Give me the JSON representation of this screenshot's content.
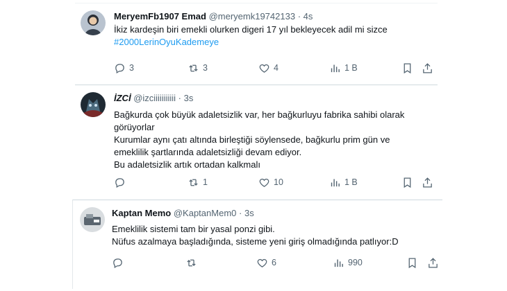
{
  "tweets": [
    {
      "name": "MeryemFb1907 Emad",
      "handle": "@meryemk19742133",
      "sep": "·",
      "time": "4s",
      "lines": [
        "İkiz kardeşin biri emekli olurken digeri 17 yıl bekleyecek adil mi sizce"
      ],
      "hashtag": "#2000LerinOyuKademeye",
      "replies": "3",
      "retweets": "3",
      "likes": "4",
      "views": "1 B"
    },
    {
      "name": "İZCİ",
      "handle": "@izciiiiiiiiiii",
      "sep": "·",
      "time": "3s",
      "lines": [
        "Bağkurda çok büyük adaletsizlik var, her bağkurluyu fabrika sahibi olarak",
        "görüyorlar",
        "Kurumlar aynı çatı altında birleştiği söylensede, bağkurlu  prim gün ve",
        "emeklilik şartlarında adaletsizliği devam ediyor.",
        "Bu adaletsizlik artık ortadan kalkmalı"
      ],
      "replies": "",
      "retweets": "1",
      "likes": "10",
      "views": "1 B"
    },
    {
      "name": "Kaptan Memo",
      "handle": "@KaptanMem0",
      "sep": "·",
      "time": "3s",
      "lines": [
        "Emeklilik sistemi tam bir yasal ponzi gibi.",
        "Nüfus azalmaya başladığında, sisteme yeni giriş olmadığında patlıyor:D"
      ],
      "replies": "",
      "retweets": "",
      "likes": "6",
      "views": "990"
    }
  ],
  "colors": {
    "text": "#0f1419",
    "muted": "#536471",
    "link": "#1d9bf0",
    "border": "#eff3f4"
  },
  "icons": [
    "reply-icon",
    "retweet-icon",
    "like-icon",
    "views-icon",
    "bookmark-icon",
    "share-icon"
  ]
}
